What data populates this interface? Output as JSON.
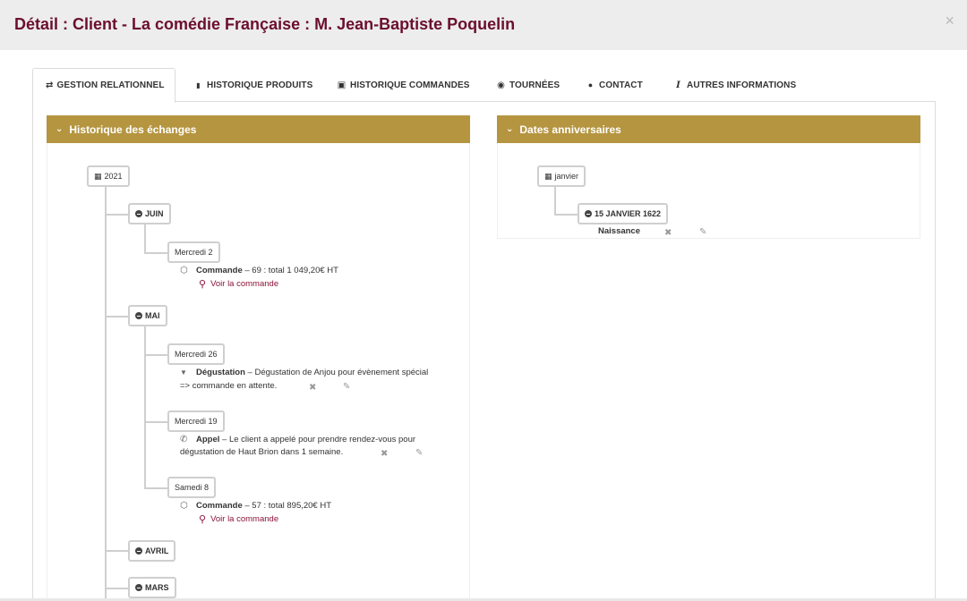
{
  "modal": {
    "title": "Détail : Client - La comédie Française : M. Jean-Baptiste Poquelin",
    "close": "×"
  },
  "tabs": [
    {
      "label": "GESTION RELATIONNEL",
      "icon": "exchange-icon",
      "glyph": "⇄"
    },
    {
      "label": "HISTORIQUE PRODUITS",
      "icon": "bottle-icon",
      "glyph": "🍷"
    },
    {
      "label": "HISTORIQUE COMMANDES",
      "icon": "box-icon",
      "glyph": "▣"
    },
    {
      "label": "TOURNÉES",
      "icon": "target-icon",
      "glyph": "◉"
    },
    {
      "label": "CONTACT",
      "icon": "user-icon",
      "glyph": "👤"
    },
    {
      "label": "AUTRES INFORMATIONS",
      "icon": "info-icon",
      "glyph": "i"
    }
  ],
  "left_panel": {
    "title": "Historique des échanges",
    "year": "2021",
    "months": {
      "juin": "JUIN",
      "mai": "MAI",
      "avril": "AVRIL",
      "mars": "MARS"
    },
    "days": {
      "d1": "Mercredi 2",
      "d2": "Mercredi 26",
      "d3": "Mercredi 19",
      "d4": "Samedi 8"
    },
    "entries": {
      "e1": {
        "type": "Commande",
        "text": " – 69 : total 1 049,20€ HT",
        "link": "Voir la commande"
      },
      "e2": {
        "type": "Dégustation",
        "text": " – Dégustation de Anjou pour évènement spécial",
        "text2": "=> commande en attente."
      },
      "e3": {
        "type": "Appel",
        "text": " – Le client a appelé pour prendre rendez-vous pour",
        "text2": "dégustation de Haut Brion dans 1 semaine."
      },
      "e4": {
        "type": "Commande",
        "text": " – 57 : total 895,20€ HT",
        "link": "Voir la commande"
      }
    }
  },
  "right_panel": {
    "title": "Dates anniversaires",
    "month": "janvier",
    "date": "15 JANVIER 1622",
    "event": "Naissance"
  },
  "icons": {
    "delete": "✖",
    "edit": "✎",
    "search": "⚲",
    "calendar": "▦",
    "chevron": "⌄",
    "phone": "✆",
    "filter": "▼",
    "box": "⬡"
  },
  "colors": {
    "title": "#6b0f2e",
    "panel_header": "#b59540",
    "link": "#8b1538"
  }
}
